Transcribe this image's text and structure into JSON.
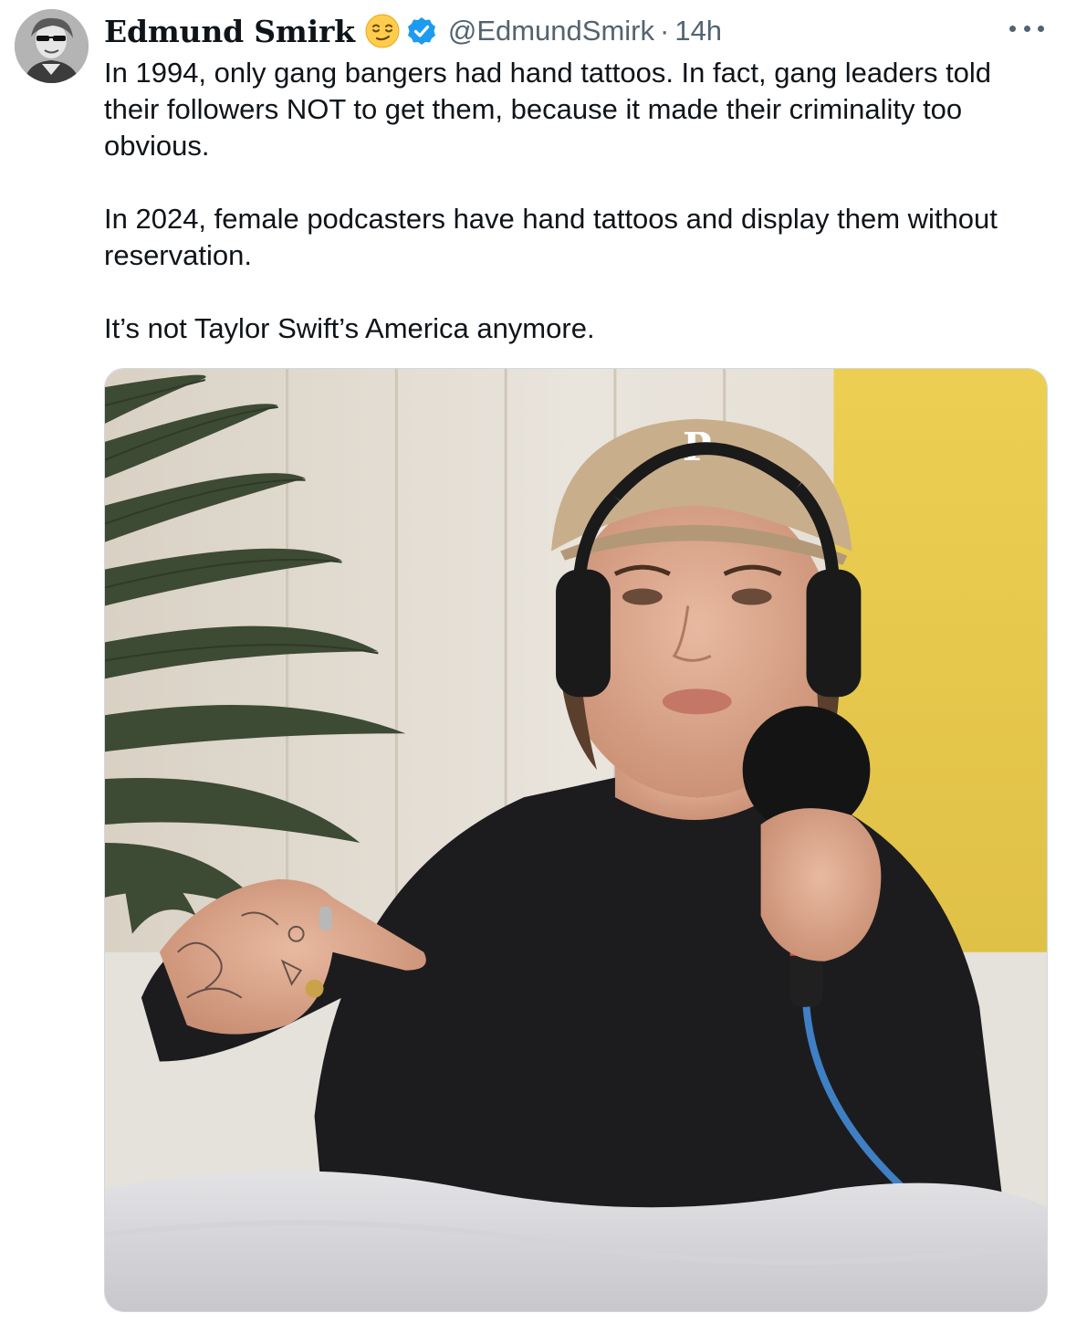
{
  "tweet": {
    "author": {
      "name": "Edmund Smirk",
      "handle": "@EdmundSmirk",
      "emoji": "relieved-face-emoji",
      "verified_badge": "verified-badge-icon"
    },
    "separator": "·",
    "timestamp": "14h",
    "more_icon": "more-options-icon",
    "text": {
      "paragraph_1": "In 1994, only gang bangers had hand tattoos. In fact, gang leaders told their followers NOT to get them, because it made their criminality too obvious.",
      "paragraph_2": "In 2024, female podcasters have hand tattoos and display them without reservation.",
      "paragraph_3": "It’s not Taylor Swift’s America anymore."
    },
    "media": {
      "type": "photo",
      "cap_letter": "P"
    }
  },
  "colors": {
    "text_primary": "#0f1419",
    "text_secondary": "#536471",
    "verified_blue": "#1d9bf0",
    "media_border": "#cfd9de"
  }
}
